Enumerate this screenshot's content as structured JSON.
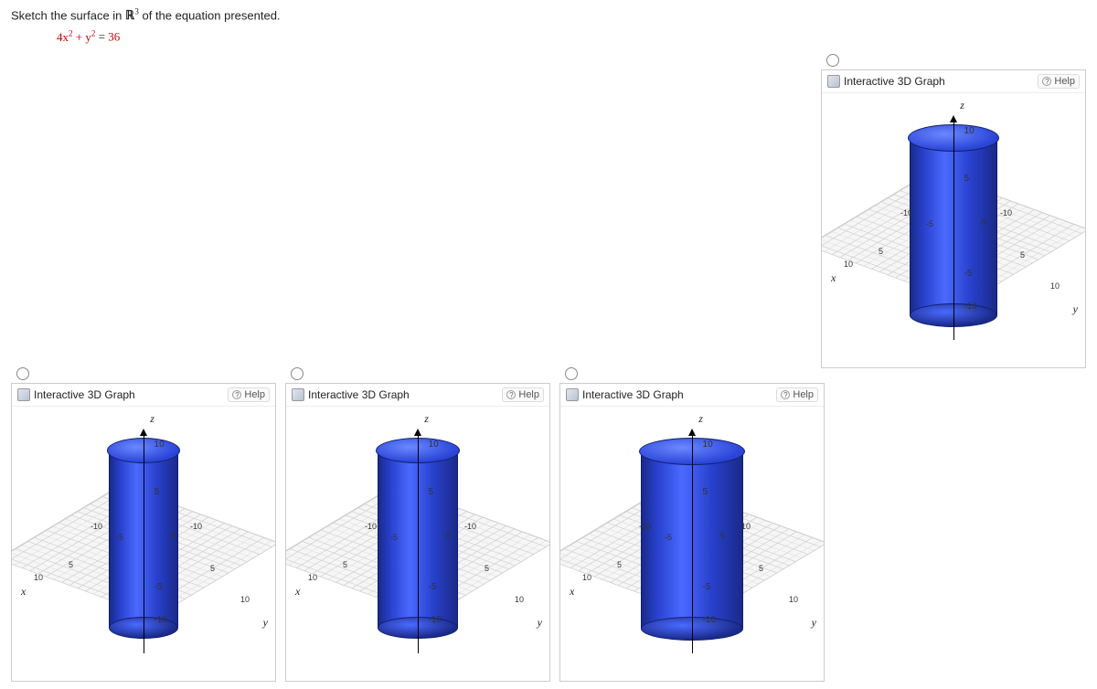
{
  "question": {
    "prefix": "Sketch the surface in ",
    "space_symbol": "ℝ",
    "space_exp": "3",
    "suffix": " of the equation presented."
  },
  "equation": {
    "lhs": "4x",
    "exp1": "2",
    "mid": " + y",
    "exp2": "2",
    "eq": " = ",
    "rhs": "36"
  },
  "graph": {
    "title": "Interactive 3D Graph",
    "help": "Help",
    "axis_labels": {
      "x": "x",
      "y": "y",
      "z": "z"
    },
    "z_ticks": [
      "10",
      "5",
      "-5",
      "-10"
    ],
    "plane_ticks": [
      "-10",
      "-5",
      "5",
      "10"
    ]
  },
  "chart_data": {
    "type": "3d-surface",
    "equation": "4x^2 + y^2 = 36",
    "surface": "elliptic cylinder (axis along z)",
    "semi_axes": {
      "x": 3,
      "y": 6
    },
    "x_range": [
      -10,
      10
    ],
    "y_range": [
      -10,
      10
    ],
    "z_range": [
      -10,
      10
    ],
    "xlabel": "x",
    "ylabel": "y",
    "zlabel": "z",
    "grid": true,
    "options_count": 4,
    "note": "Four multiple-choice renderings of the same blue cylinder on a gray grid; one placed top-right, three on a lower row. None selected."
  }
}
